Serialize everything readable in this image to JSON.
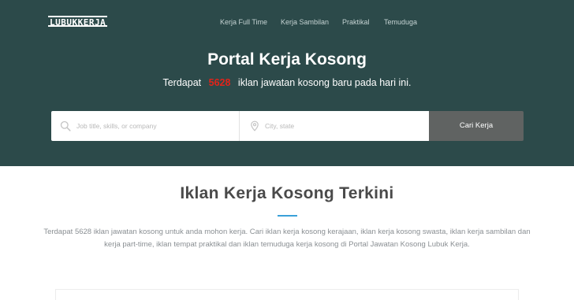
{
  "brand": {
    "logo": "LUBUKKERJA"
  },
  "nav": {
    "items": [
      {
        "label": "Kerja Full Time"
      },
      {
        "label": "Kerja Sambilan"
      },
      {
        "label": "Praktikal"
      },
      {
        "label": "Temuduga"
      }
    ]
  },
  "hero": {
    "title": "Portal Kerja Kosong",
    "subtitle_before": "Terdapat",
    "job_count": "5628",
    "subtitle_after": "iklan jawatan kosong baru pada hari ini."
  },
  "search": {
    "job_placeholder": "Job title, skills, or company",
    "job_value": "",
    "location_placeholder": "City, state",
    "location_value": "",
    "button_label": "Cari Kerja",
    "job_icon": "search-icon",
    "location_icon": "location-pin-icon"
  },
  "section": {
    "title": "Iklan Kerja Kosong Terkini",
    "description": "Terdapat 5628 iklan jawatan kosong untuk anda mohon kerja. Cari iklan kerja kosong kerajaan, iklan kerja kosong swasta, iklan kerja sambilan dan kerja part-time, iklan tempat praktikal dan iklan temuduga kerja kosong di Portal Jawatan Kosong Lubuk Kerja."
  },
  "colors": {
    "hero_bg": "#2c4a4a",
    "count_highlight": "#e2231a",
    "button_bg": "#606362",
    "accent_rule": "#3aa0d9"
  }
}
